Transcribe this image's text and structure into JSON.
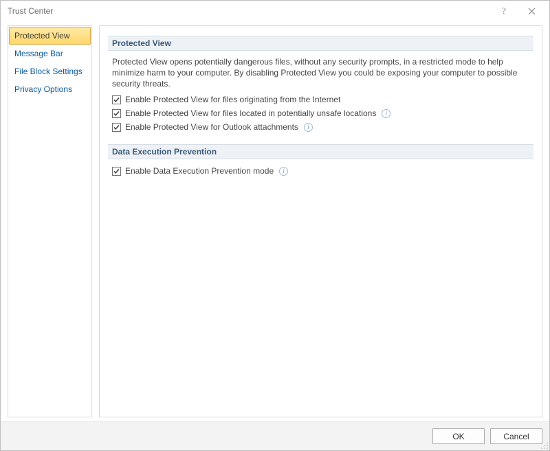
{
  "window": {
    "title": "Trust Center"
  },
  "sidebar": {
    "items": [
      {
        "label": "Protected View",
        "selected": true
      },
      {
        "label": "Message Bar",
        "selected": false
      },
      {
        "label": "File Block Settings",
        "selected": false
      },
      {
        "label": "Privacy Options",
        "selected": false
      }
    ]
  },
  "sections": {
    "protected_view": {
      "header": "Protected View",
      "description": "Protected View opens potentially dangerous files, without any security prompts, in a restricted mode to help minimize harm to your computer. By disabling Protected View you could be exposing your computer to possible security threats.",
      "checks": [
        {
          "label": "Enable Protected View for files originating from the Internet",
          "checked": true,
          "info": false
        },
        {
          "label": "Enable Protected View for files located in potentially unsafe locations",
          "checked": true,
          "info": true
        },
        {
          "label": "Enable Protected View for Outlook attachments",
          "checked": true,
          "info": true
        }
      ]
    },
    "dep": {
      "header": "Data Execution Prevention",
      "checks": [
        {
          "label": "Enable Data Execution Prevention mode",
          "checked": true,
          "info": true
        }
      ]
    }
  },
  "footer": {
    "ok": "OK",
    "cancel": "Cancel"
  }
}
